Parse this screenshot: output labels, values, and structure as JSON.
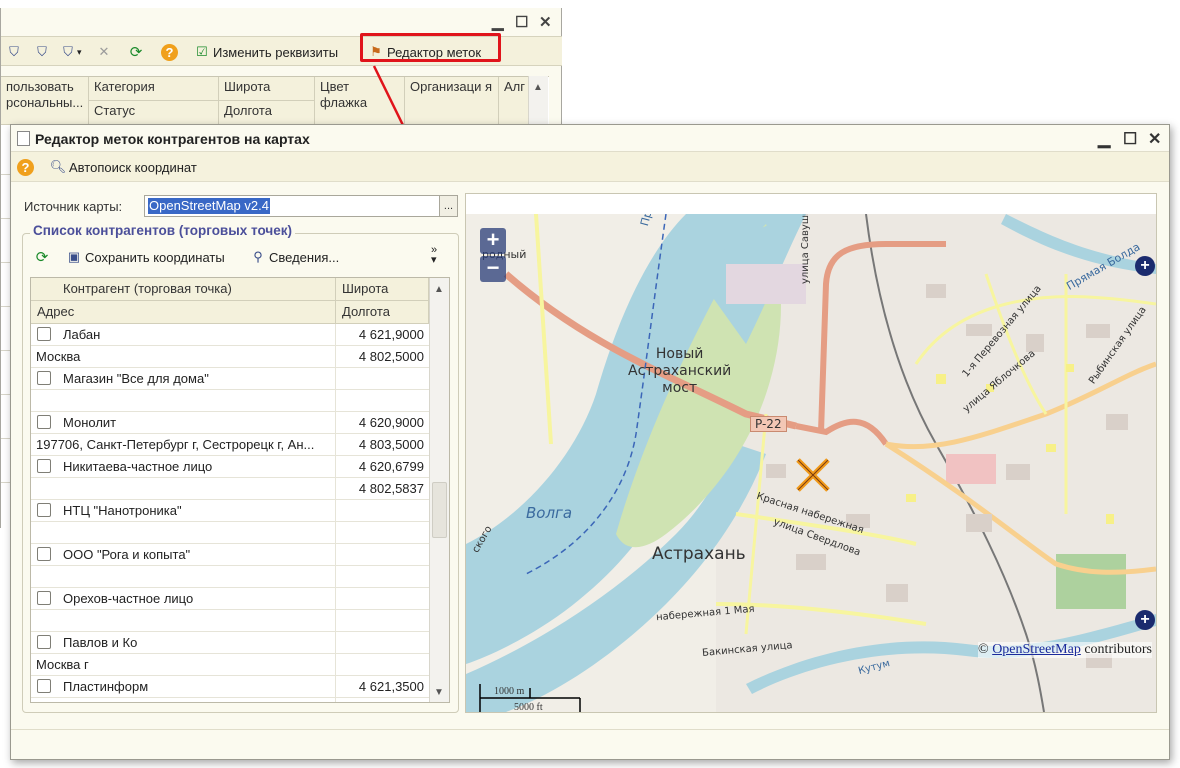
{
  "bg_window": {
    "toolbar": {
      "edit_details_label": "Изменить реквизиты",
      "tag_editor_label": "Редактор меток"
    },
    "columns": [
      {
        "top": "пользовать",
        "bottom": "рсональны..."
      },
      {
        "top": "Категория",
        "bottom": "Статус"
      },
      {
        "top": "Широта",
        "bottom": "Долгота"
      },
      {
        "top": "Цвет флажка",
        "bottom": ""
      },
      {
        "top": "Организаци я",
        "bottom": ""
      },
      {
        "top": "Алг",
        "bottom": ""
      }
    ]
  },
  "window": {
    "title": "Редактор меток контрагентов на картах",
    "toolbar": {
      "autosearch_label": "Автопоиск координат"
    }
  },
  "source": {
    "label": "Источник карты:",
    "value": "OpenStreetMap v2.4",
    "button": "..."
  },
  "group": {
    "title": "Список контрагентов (торговых точек)",
    "toolbar": {
      "save_label": "Сохранить координаты",
      "info_label": "Сведения..."
    }
  },
  "list": {
    "headers": {
      "name": "Контрагент (торговая точка)",
      "address": "Адрес",
      "lat": "Широта",
      "lon": "Долгота"
    },
    "items": [
      {
        "name": "Лабан",
        "lat": "4 621,9000",
        "address": "Москва",
        "lon": "4 802,5000"
      },
      {
        "name": "Магазин \"Все для дома\"",
        "lat": "",
        "address": "",
        "lon": ""
      },
      {
        "name": "Монолит",
        "lat": "4 620,9000",
        "address": "197706, Санкт-Петербург г, Сестрорецк г, Ан...",
        "lon": "4 803,5000"
      },
      {
        "name": "Никитаева-частное лицо",
        "lat": "4 620,6799",
        "address": "",
        "lon": "4 802,5837"
      },
      {
        "name": "НТЦ \"Нанотроника\"",
        "lat": "",
        "address": "",
        "lon": ""
      },
      {
        "name": "ООО \"Рога и копыта\"",
        "lat": "",
        "address": "",
        "lon": ""
      },
      {
        "name": "Орехов-частное лицо",
        "lat": "",
        "address": "",
        "lon": ""
      },
      {
        "name": "Павлов и Ко",
        "lat": "",
        "address": "Москва г",
        "lon": ""
      },
      {
        "name": "Пластинформ",
        "lat": "4 621,3500",
        "address": "",
        "lon": ""
      }
    ]
  },
  "map": {
    "labels": {
      "bridge": [
        "Новый",
        "Астраханский",
        "мост"
      ],
      "city": "Астрахань",
      "river": "Волга",
      "road": "P-22",
      "street_savushkina": "улица Савушкина",
      "street_sverdlova": "улица Свердлова",
      "street_embankment": "Красная набережная",
      "street_1may": "набережная 1 Мая",
      "street_bakinskaya": "Бакинская улица",
      "street_yablochkova": "улица Яблочкова",
      "street_pereyaslavskaya": "1-я Перевозная улица",
      "street_pryamaya": "Прямая Болда",
      "street_rybinskaya": "Рыбинская улица",
      "street_kutum": "Кутум",
      "walk": "Прогулка по Волге",
      "fragment": "родный",
      "fragment2": "ского"
    },
    "zoom_in": "+",
    "zoom_out": "−",
    "attribution_prefix": "©",
    "attribution_link": "OpenStreetMap",
    "attribution_suffix": "contributors",
    "scale_metric": "1000 m",
    "scale_imperial": "5000 ft"
  },
  "colors": {
    "accent_title": "#4b4f9a",
    "highlight": "#e0141b",
    "selection": "#3968c6"
  }
}
